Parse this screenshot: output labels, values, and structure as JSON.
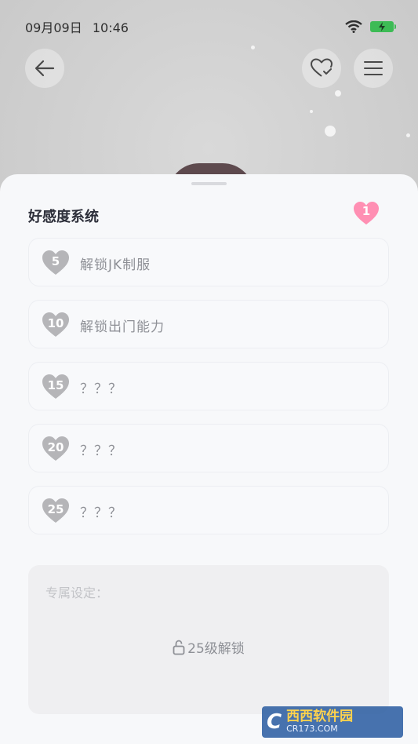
{
  "status_bar": {
    "date": "09月09日",
    "time": "10:46"
  },
  "panel": {
    "title": "好感度系统",
    "current_level": "1",
    "items": [
      {
        "level": "5",
        "label": "解锁JK制服"
      },
      {
        "level": "10",
        "label": "解锁出门能力"
      },
      {
        "level": "15",
        "label": "？？？"
      },
      {
        "level": "20",
        "label": "？？？"
      },
      {
        "level": "25",
        "label": "？？？"
      }
    ],
    "exclusive": {
      "label": "专属设定：",
      "lock_text": "25级解锁"
    }
  },
  "watermark": {
    "logo": "C",
    "name": "西西软件园",
    "url": "CR173.COM"
  },
  "colors": {
    "heart_active": "#ff8fb3",
    "heart_inactive": "#b5b5b8",
    "battery": "#3dbb55"
  },
  "icons": [
    "back-arrow-icon",
    "heart-check-icon",
    "menu-icon",
    "wifi-icon",
    "battery-icon",
    "lock-icon"
  ]
}
